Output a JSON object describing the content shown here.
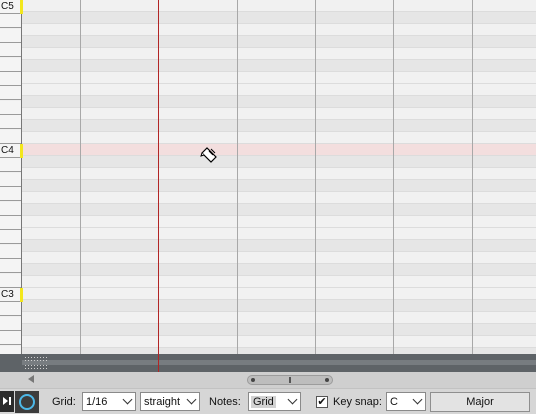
{
  "piano_roll": {
    "key_labels": {
      "c5": "C5",
      "c4": "C4",
      "c3": "C3"
    },
    "highlighted_row_color": "#f3dede",
    "playhead_color": "#b22525",
    "key_marker_color": "#f3e71c"
  },
  "toolbar": {
    "grid_label": "Grid:",
    "grid_value": "1/16",
    "grid_type_value": "straight",
    "notes_label": "Notes:",
    "notes_value": "Grid",
    "key_snap_checked": true,
    "key_snap_check_glyph": "✔",
    "key_snap_label": "Key snap:",
    "key_snap_value": "C",
    "scale_button_label": "Major"
  },
  "icons": [
    "play-stop-icon",
    "loop-icon",
    "pencil-cursor-icon",
    "scroll-left-arrow-icon"
  ]
}
